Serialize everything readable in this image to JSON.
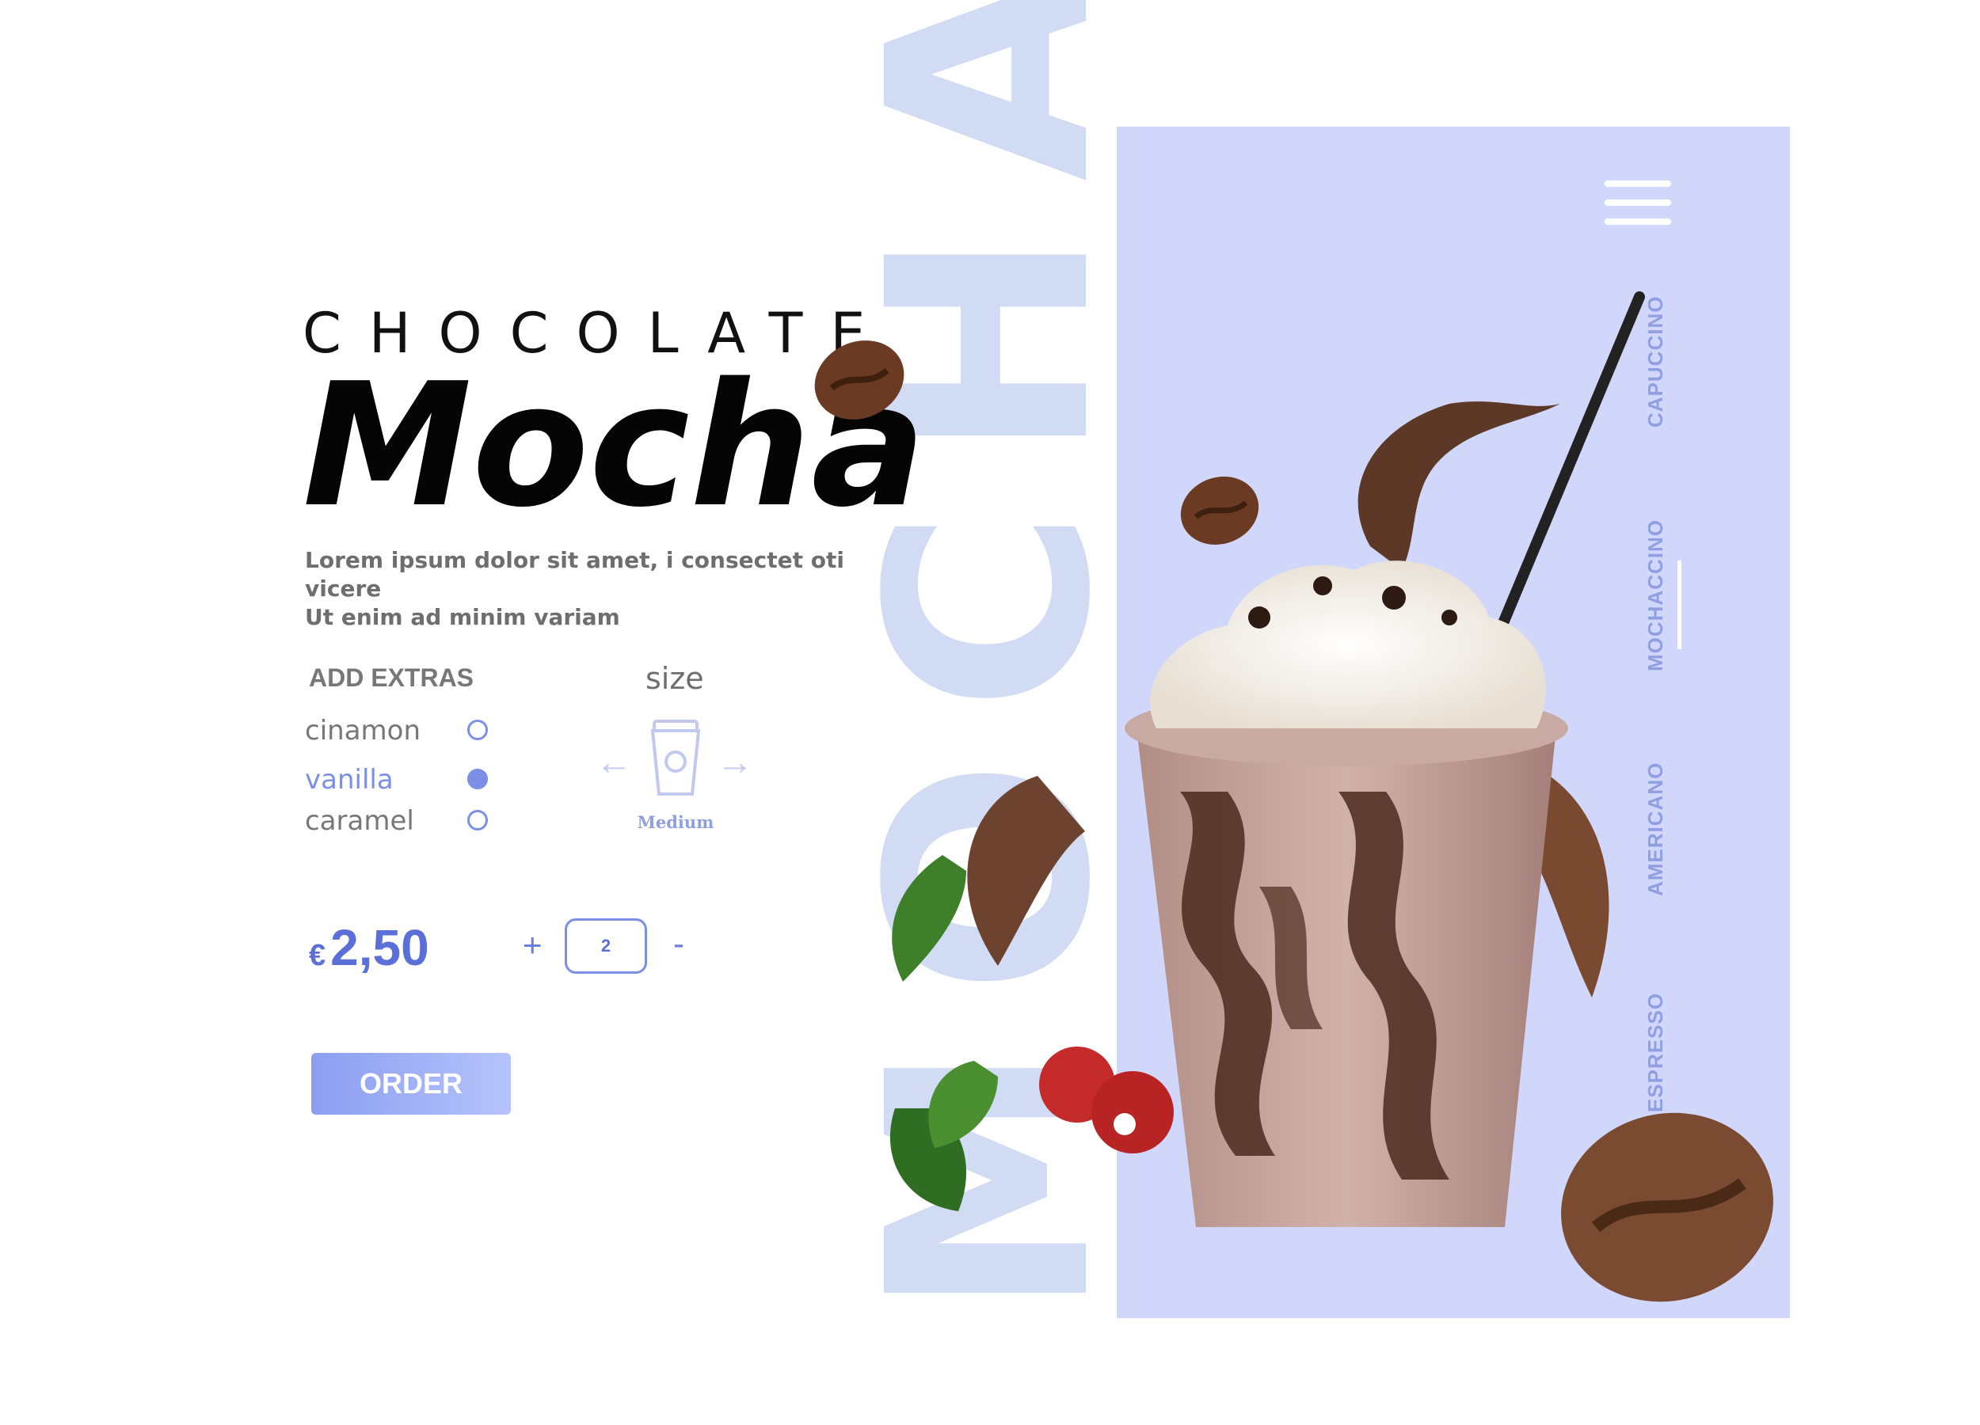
{
  "hero": {
    "subtitle": "CHOCOLATE",
    "title": "Mocha",
    "description_line1": "Lorem ipsum dolor sit amet, i consectet oti vicere",
    "description_line2": "Ut enim ad minim variam",
    "watermark": "MOCHA"
  },
  "extras": {
    "title": "ADD EXTRAS",
    "items": [
      {
        "label": "cinamon",
        "selected": false
      },
      {
        "label": "vanilla",
        "selected": true
      },
      {
        "label": "caramel",
        "selected": false
      }
    ]
  },
  "size": {
    "title": "size",
    "value": "Medium",
    "prev_icon": "arrow-left-icon",
    "next_icon": "arrow-right-icon",
    "cup_icon": "coffee-cup-icon"
  },
  "pricing": {
    "currency": "€",
    "amount": "2,50",
    "plus": "+",
    "quantity": "2",
    "minus": "-"
  },
  "order_button": "ORDER",
  "nav": {
    "menu_icon": "hamburger-menu-icon",
    "items": [
      "CAPUCCINO",
      "MOCHACCINO",
      "AMERICANO",
      "ESPRESSO"
    ],
    "active": "MOCHACCINO"
  },
  "colors": {
    "accent": "#7b8fe6",
    "panel": "#d0d7fb",
    "watermark": "#d1dbf3",
    "title": "#050505"
  }
}
